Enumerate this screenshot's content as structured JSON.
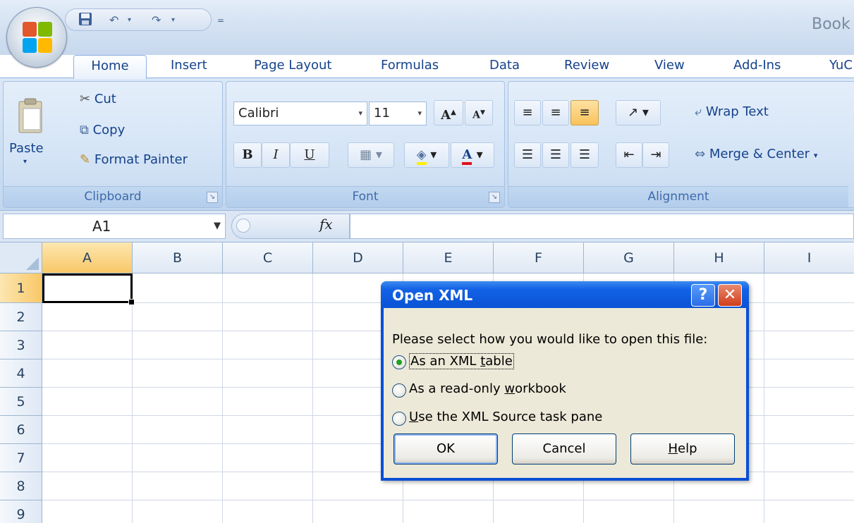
{
  "titlebar": {
    "app_title": "Book",
    "qat_customize": "="
  },
  "tabs": [
    "Home",
    "Insert",
    "Page Layout",
    "Formulas",
    "Data",
    "Review",
    "View",
    "Add-Ins",
    "YuC"
  ],
  "ribbon": {
    "clipboard": {
      "label": "Clipboard",
      "paste": "Paste",
      "cut": "Cut",
      "copy": "Copy",
      "format_painter": "Format Painter"
    },
    "font": {
      "label": "Font",
      "font_name": "Calibri",
      "font_size": "11",
      "bold": "B",
      "italic": "I",
      "underline": "U",
      "grow": "A",
      "shrink": "A",
      "font_color": "A"
    },
    "alignment": {
      "label": "Alignment",
      "wrap_text": "Wrap Text",
      "merge_center": "Merge & Center"
    }
  },
  "formula_bar": {
    "name_box": "A1",
    "fx": "fx",
    "formula": ""
  },
  "grid": {
    "columns": [
      "A",
      "B",
      "C",
      "D",
      "E",
      "F",
      "G",
      "H",
      "I"
    ],
    "rows": [
      "1",
      "2",
      "3",
      "4",
      "5",
      "6",
      "7",
      "8",
      "9"
    ],
    "active_cell": "A1"
  },
  "dialog": {
    "title": "Open XML",
    "help_glyph": "?",
    "close_glyph": "✕",
    "prompt": "Please select how you would like to open this file:",
    "options": [
      {
        "pre": "As an XML ",
        "key": "t",
        "post": "able",
        "checked": true
      },
      {
        "pre": "As a read-only ",
        "key": "w",
        "post": "orkbook",
        "checked": false
      },
      {
        "pre": "",
        "key": "U",
        "post": "se the XML Source task pane",
        "checked": false
      }
    ],
    "ok": "OK",
    "cancel": "Cancel",
    "help_pre": "",
    "help_key": "H",
    "help_post": "elp"
  },
  "colors": {
    "accent": "#15428b",
    "selection": "#f8c868",
    "dialog_title": "#0a53d4"
  }
}
